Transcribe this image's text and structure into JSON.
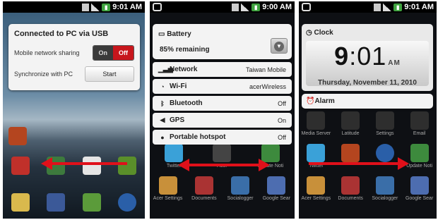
{
  "status_bars": [
    {
      "time": "9:01 AM"
    },
    {
      "time": "9:00 AM"
    },
    {
      "time": "9:01 AM"
    }
  ],
  "panel1": {
    "title": "Connected to PC via USB",
    "sharing_label": "Mobile network sharing",
    "toggle_on": "On",
    "toggle_off": "Off",
    "sync_label": "Synchronize with PC",
    "start_button": "Start"
  },
  "panel2": {
    "battery_title": "Battery",
    "battery_value": "85% remaining",
    "toggles": [
      {
        "label": "Network",
        "value": "Taiwan Mobile",
        "icon": "signal-icon"
      },
      {
        "label": "Wi-Fi",
        "value": "acerWireless",
        "icon": "wifi-icon"
      },
      {
        "label": "Bluetooth",
        "value": "Off",
        "icon": "bluetooth-icon"
      },
      {
        "label": "GPS",
        "value": "On",
        "icon": "gps-icon"
      },
      {
        "label": "Portable hotspot",
        "value": "Off",
        "icon": "hotspot-icon"
      }
    ],
    "app_labels": [
      "Twitter",
      "Acer",
      "Update Noti",
      "Acer Settings",
      "Documents",
      "Socialogger",
      "Google Sear"
    ]
  },
  "panel3": {
    "clock_title": "Clock",
    "hour": "9",
    "minute": ":01",
    "ampm": "AM",
    "date": "Thursday, November 11, 2010",
    "alarm_title": "Alarm",
    "app_labels": [
      "Media Server",
      "Latitude",
      "Settings",
      "Email",
      "Twitter",
      "Update Noti",
      "Acer Settings",
      "Documents",
      "Socialogger",
      "Google Sear"
    ]
  },
  "colors": {
    "accent_red": "#e0101a",
    "toggle_off": "#c7161c"
  }
}
